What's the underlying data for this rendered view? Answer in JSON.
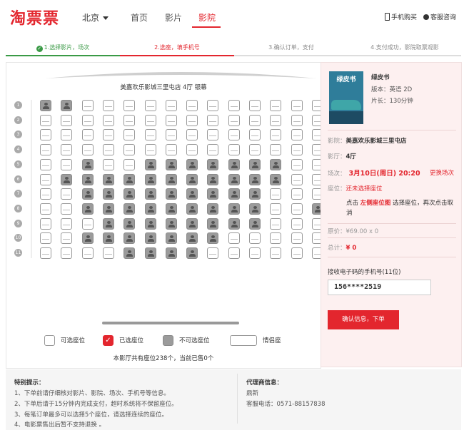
{
  "header": {
    "logo": "淘票票",
    "city": "北京",
    "nav": [
      {
        "label": "首页",
        "active": false
      },
      {
        "label": "影片",
        "active": false
      },
      {
        "label": "影院",
        "active": true
      }
    ],
    "mobile_buy": "手机购买",
    "customer_service": "客服咨询"
  },
  "steps": [
    {
      "label": "1.选择影片，场次",
      "state": "done"
    },
    {
      "label": "2.选座，填手机号",
      "state": "current"
    },
    {
      "label": "3.确认订单，支付",
      "state": "todo"
    },
    {
      "label": "4.支付成功，影院取票观影",
      "state": "todo"
    }
  ],
  "seat_map": {
    "hall_name": "美嘉欢乐影城三里屯店 4厅 银幕",
    "row_labels": [
      "1",
      "2",
      "3",
      "4",
      "5",
      "6",
      "7",
      "8",
      "9",
      "10",
      "11"
    ],
    "rows": [
      "XXAAAAAAAAAAAA",
      "AAAAAAAAAAAAAA",
      "AAAAAAAAAAAAAA",
      "AAAAAAAAAAAAAA",
      "AAXAAXXXXXXXAA",
      "AXXXXXXXXXXXAA",
      "AAXXXXXXXXXAAA",
      "AAXXXXXXXXXAAX",
      "AAAXXXXXXXXAAA",
      "AAXXXXXXXAAAAA",
      "AAAAXXXXAAAAAA"
    ],
    "legend": {
      "available": "可选座位",
      "selected": "已选座位",
      "unavailable": "不可选座位",
      "couple": "情侣座"
    },
    "summary": "本影厅共有座位238个，当前已售0个"
  },
  "sidebar": {
    "movie_title": "绿皮书",
    "poster_text": "绿皮书",
    "version_label": "版本：",
    "version": "英语 2D",
    "duration_label": "片长：",
    "duration": "130分钟",
    "cinema_label": "影院：",
    "cinema": "美嘉欢乐影城三里屯店",
    "hall_label": "影厅：",
    "hall": "4厅",
    "showtime_label": "场次：",
    "showtime": "3月10日(周日) 20:20",
    "change_showtime": "更换场次",
    "seat_label": "座位：",
    "seat_value": "还未选择座位",
    "hint_prefix": "点击",
    "hint_link": "左侧座位图",
    "hint_suffix": "选择座位，再次点击取消",
    "price_label": "原价：",
    "price": "¥69.00 x 0",
    "total_label": "总计：",
    "total": "¥ 0",
    "phone_label": "接收电子码的手机号(11位)",
    "phone_value": "156****2519",
    "confirm_button": "确认信息，下单"
  },
  "notice": {
    "title": "特别提示：",
    "lines": [
      "1、下单前请仔细核对影片、影院、场次、手机号等信息。",
      "2、下单后请于15分钟内完成支付，超时系统将不保留座位。",
      "3、每笔订单最多可以选择5个座位，请选择连续的座位。",
      "4、电影票售出后暂不支持退换 。"
    ],
    "agent_title": "代理商信息：",
    "agent_name": "鼎新",
    "agent_phone_label": "客服电话：",
    "agent_phone": "0571-88157838"
  },
  "colors": {
    "brand": "#e3262e",
    "done": "#3a9a46",
    "sold_seat": "#9b9b9b"
  }
}
